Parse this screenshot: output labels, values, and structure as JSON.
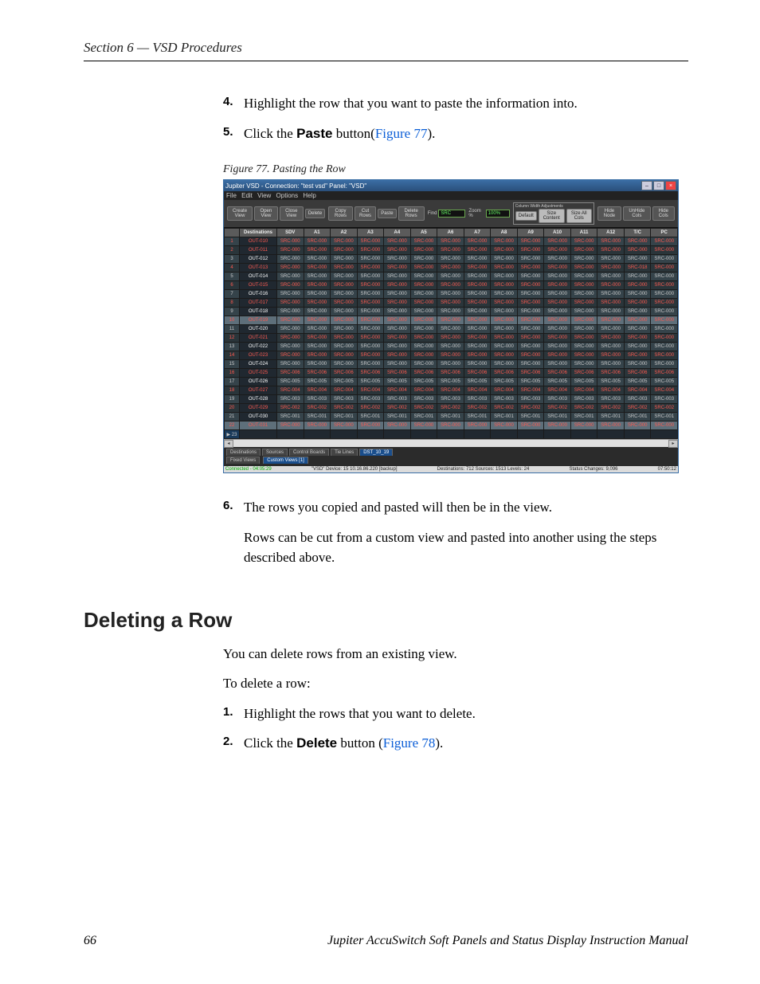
{
  "header": {
    "section": "Section 6 — VSD Procedures"
  },
  "steps_a": [
    {
      "n": "4.",
      "pre": "Highlight the row that you want to paste the information into.",
      "bold": "",
      "post": ""
    },
    {
      "n": "5.",
      "pre": "Click the ",
      "bold": "Paste",
      "post": " button(",
      "link": "Figure 77",
      "tail": ")."
    }
  ],
  "figure": {
    "caption": "Figure 77.  Pasting the Row",
    "titlebar": "Jupiter VSD - Connection: \"test vsd\"   Panel: \"VSD\"",
    "menus": "File  Edit  View  Options  Help",
    "toolbar": {
      "create": "Create View",
      "open": "Open View",
      "close": "Close View",
      "delete": "Delete",
      "copy": "Copy Rows",
      "cut": "Cut Rows",
      "paste": "Paste",
      "delrows": "Delete Rows",
      "find": "Find",
      "find_val": "SRC",
      "zoom": "Zoom %",
      "zoom_val": "100%",
      "cwa_title": "Column Width Adjustments",
      "default": "Default",
      "sizecontent": "Size Content",
      "sizeall": "Size All Cols",
      "hide": "Hide Node",
      "unhide": "UnHide Cols",
      "hidecols": "Hide Cols"
    },
    "columns": [
      "",
      "Destinations",
      "SDV",
      "A1",
      "A2",
      "A3",
      "A4",
      "A5",
      "A6",
      "A7",
      "A8",
      "A9",
      "A10",
      "A11",
      "A12",
      "T/C",
      "PC"
    ],
    "rows": [
      {
        "n": "1",
        "dest": "OUT-010",
        "src": "SRC-000",
        "cls": "sel-red",
        "stripe": "odd"
      },
      {
        "n": "2",
        "dest": "OUT-011",
        "src": "SRC-000",
        "cls": "sel-red",
        "stripe": "even"
      },
      {
        "n": "3",
        "dest": "OUT-012",
        "src": "SRC-000",
        "cls": "",
        "stripe": "odd"
      },
      {
        "n": "4",
        "dest": "OUT-013",
        "src": "SRC-000",
        "cls": "sel-red",
        "stripe": "even",
        "last": "SRC-018"
      },
      {
        "n": "5",
        "dest": "OUT-014",
        "src": "SRC-000",
        "cls": "",
        "stripe": "odd"
      },
      {
        "n": "6",
        "dest": "OUT-015",
        "src": "SRC-000",
        "cls": "sel-red",
        "stripe": "even"
      },
      {
        "n": "7",
        "dest": "OUT-016",
        "src": "SRC-000",
        "cls": "",
        "stripe": "odd"
      },
      {
        "n": "8",
        "dest": "OUT-017",
        "src": "SRC-000",
        "cls": "sel-red",
        "stripe": "even"
      },
      {
        "n": "9",
        "dest": "OUT-018",
        "src": "SRC-000",
        "cls": "",
        "stripe": "odd"
      },
      {
        "n": "10",
        "dest": "OUT-019",
        "src": "SRC-000",
        "cls": "sel-red sel-hl",
        "stripe": "even"
      },
      {
        "n": "11",
        "dest": "OUT-020",
        "src": "SRC-000",
        "cls": "",
        "stripe": "odd"
      },
      {
        "n": "12",
        "dest": "OUT-021",
        "src": "SRC-000",
        "cls": "sel-red",
        "stripe": "even"
      },
      {
        "n": "13",
        "dest": "OUT-022",
        "src": "SRC-000",
        "cls": "",
        "stripe": "odd"
      },
      {
        "n": "14",
        "dest": "OUT-023",
        "src": "SRC-000",
        "cls": "sel-red",
        "stripe": "even"
      },
      {
        "n": "15",
        "dest": "OUT-024",
        "src": "SRC-000",
        "cls": "",
        "stripe": "odd"
      },
      {
        "n": "16",
        "dest": "OUT-025",
        "src": "SRC-006",
        "cls": "sel-red",
        "stripe": "even"
      },
      {
        "n": "17",
        "dest": "OUT-026",
        "src": "SRC-005",
        "cls": "",
        "stripe": "odd"
      },
      {
        "n": "18",
        "dest": "OUT-027",
        "src": "SRC-004",
        "cls": "sel-red",
        "stripe": "even"
      },
      {
        "n": "19",
        "dest": "OUT-028",
        "src": "SRC-003",
        "cls": "",
        "stripe": "odd"
      },
      {
        "n": "20",
        "dest": "OUT-029",
        "src": "SRC-002",
        "cls": "sel-red",
        "stripe": "even"
      },
      {
        "n": "21",
        "dest": "OUT-030",
        "src": "SRC-001",
        "cls": "",
        "stripe": "odd"
      },
      {
        "n": "22",
        "dest": "OUT-031",
        "src": "SRC-000",
        "cls": "sel-red sel-hl",
        "stripe": "even"
      },
      {
        "n": "23",
        "dest": "",
        "src": "",
        "cls": "active",
        "stripe": "odd",
        "marker": "▶"
      }
    ],
    "tabs_bottom": [
      "Destinations",
      "Sources",
      "Control Boards",
      "Tie Lines",
      "DST_10_19"
    ],
    "subtabs": {
      "label": "Fixed Views",
      "custom": "Custom Views [1]"
    },
    "status": {
      "conn": "Connected - 04:05:29",
      "device": "\"VSD\" Device: 15   10.16.86.220 [backup]",
      "counts": "Destinations:  712   Sources:  1513   Levels:  24",
      "changes": "Status Changes:           9,096",
      "time": "07:50:12"
    }
  },
  "steps_b": [
    {
      "n": "6.",
      "pre": "The rows you copied and pasted will then be in the view."
    }
  ],
  "body_after_6": "Rows can be cut from a custom view and pasted into another using the steps described above.",
  "subhead": "Deleting a Row",
  "delete_intro": "You can delete rows from an existing view.",
  "delete_lead": "To delete a row:",
  "steps_c": [
    {
      "n": "1.",
      "pre": "Highlight the rows that you want to delete."
    },
    {
      "n": "2.",
      "pre": "Click the ",
      "bold": "Delete",
      "post": " button (",
      "link": "Figure 78",
      "tail": ")."
    }
  ],
  "footer": {
    "page": "66",
    "title": "Jupiter AccuSwitch Soft Panels and Status Display Instruction Manual"
  }
}
